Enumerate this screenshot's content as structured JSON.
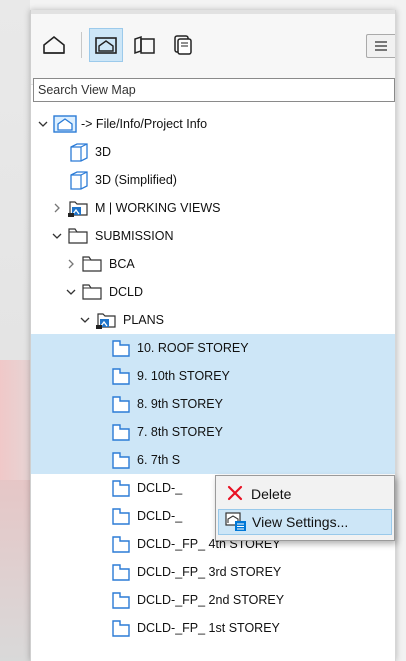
{
  "search": {
    "placeholder": "Search View Map"
  },
  "tree": [
    {
      "label": "-> File/Info/Project Info",
      "icon": "project-info-icon"
    },
    {
      "label": "3D",
      "icon": "3d-view-icon"
    },
    {
      "label": "3D (Simplified)",
      "icon": "3d-view-icon"
    },
    {
      "label": "M | WORKING VIEWS",
      "icon": "folder-clone-icon"
    },
    {
      "label": "SUBMISSION",
      "icon": "folder-icon"
    },
    {
      "label": "BCA",
      "icon": "folder-icon"
    },
    {
      "label": "DCLD",
      "icon": "folder-icon"
    },
    {
      "label": "PLANS",
      "icon": "folder-clone-icon"
    },
    {
      "label": "10. ROOF STOREY",
      "icon": "floor-plan-icon"
    },
    {
      "label": "9. 10th STOREY",
      "icon": "floor-plan-icon"
    },
    {
      "label": "8. 9th STOREY",
      "icon": "floor-plan-icon"
    },
    {
      "label": "7. 8th STOREY",
      "icon": "floor-plan-icon"
    },
    {
      "label": "6. 7th S",
      "icon": "floor-plan-icon"
    },
    {
      "label": "DCLD-_",
      "icon": "floor-plan-icon"
    },
    {
      "label": "DCLD-_",
      "icon": "floor-plan-icon"
    },
    {
      "label": "DCLD-_FP_ 4th STOREY",
      "icon": "floor-plan-icon"
    },
    {
      "label": "DCLD-_FP_ 3rd STOREY",
      "icon": "floor-plan-icon"
    },
    {
      "label": "DCLD-_FP_ 2nd STOREY",
      "icon": "floor-plan-icon"
    },
    {
      "label": "DCLD-_FP_ 1st STOREY",
      "icon": "floor-plan-icon"
    }
  ],
  "context_menu": {
    "delete_label": "Delete",
    "view_settings_label": "View Settings..."
  },
  "colors": {
    "selection": "#cde6f7",
    "accent": "#0078d7",
    "delete_red": "#e81123"
  }
}
